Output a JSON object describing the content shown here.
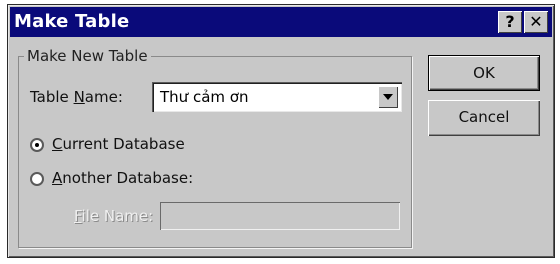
{
  "window": {
    "title": "Make Table",
    "help_label": "?",
    "close_label": "✕"
  },
  "group": {
    "label": "Make New Table"
  },
  "table_name": {
    "label_before": "Table ",
    "label_access": "N",
    "label_after": "ame:",
    "value": "Thư cảm ơn"
  },
  "options": {
    "current_db_access": "C",
    "current_db_rest": "urrent Database",
    "current_selected": true,
    "another_db_access": "A",
    "another_db_rest": "nother Database:"
  },
  "file_name": {
    "label_access": "F",
    "label_rest": "ile Name:",
    "value": ""
  },
  "buttons": {
    "ok": "OK",
    "cancel": "Cancel"
  }
}
